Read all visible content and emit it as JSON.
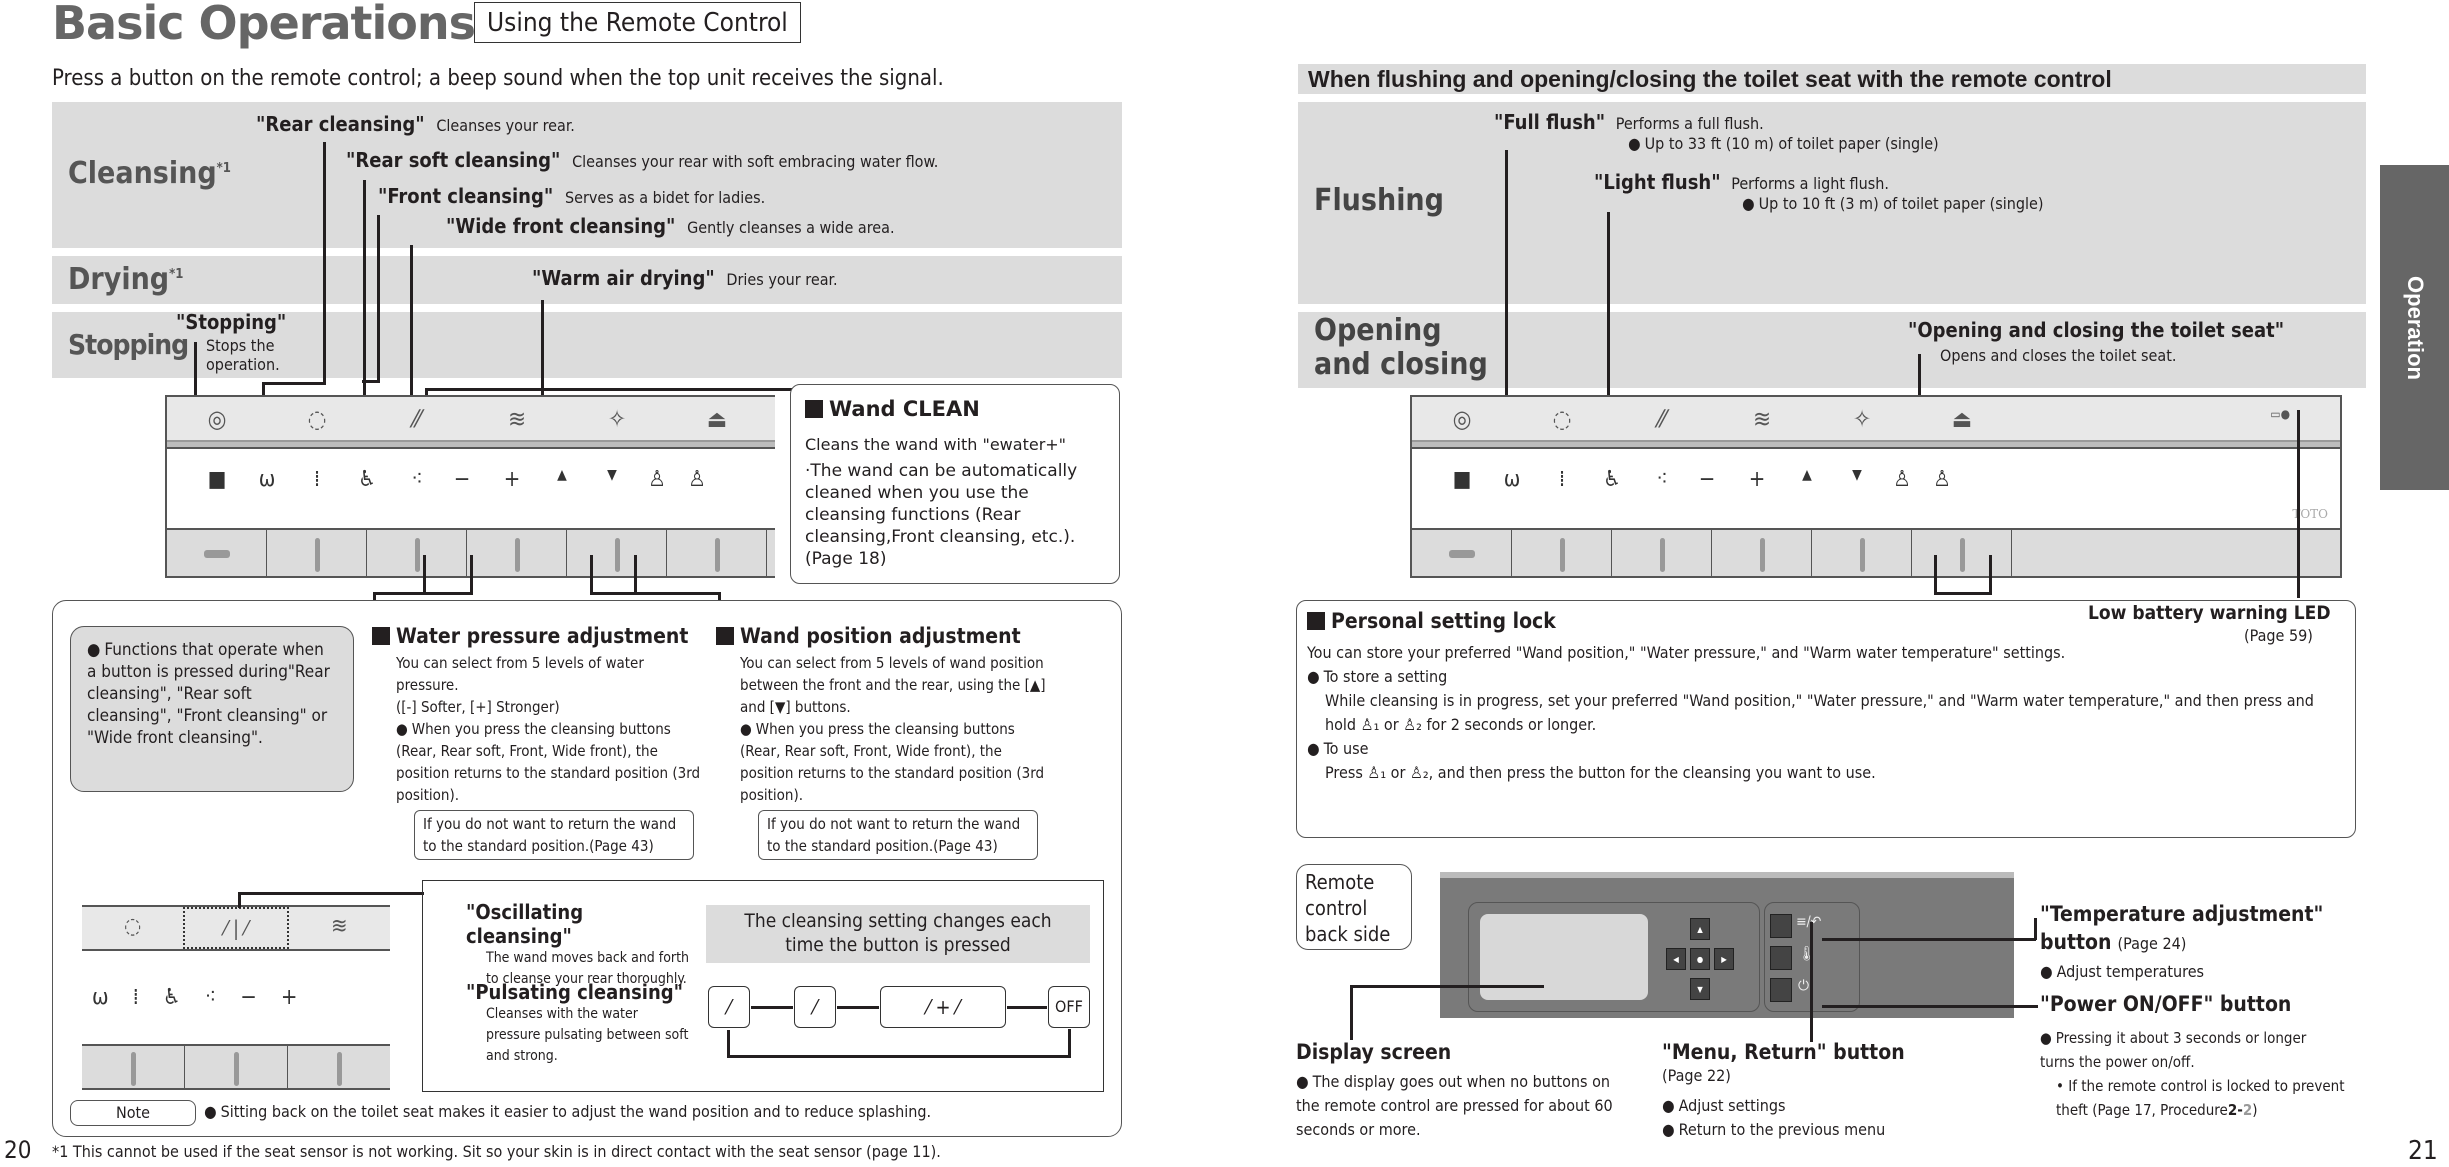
{
  "left_page": {
    "title": "Basic Operations",
    "subtitle": "Using the Remote Control",
    "intro": "Press a button on the remote control; a beep sound when the top unit receives the signal.",
    "sections": {
      "cleansing": {
        "label": "Cleansing",
        "sup": "*1"
      },
      "drying": {
        "label": "Drying",
        "sup": "*1"
      },
      "stopping": {
        "label": "Stopping"
      }
    },
    "functions": [
      {
        "name": "\"Rear cleansing\"",
        "desc": "Cleanses your rear."
      },
      {
        "name": "\"Rear soft cleansing\"",
        "desc": "Cleanses your rear with soft embracing water flow."
      },
      {
        "name": "\"Front cleansing\"",
        "desc": "Serves as a bidet for ladies."
      },
      {
        "name": "\"Wide front cleansing\"",
        "desc": "Gently cleanses a wide area."
      },
      {
        "name": "\"Warm air drying\"",
        "desc": "Dries your rear."
      },
      {
        "name": "\"Stopping\"",
        "desc": "Stops the operation."
      }
    ],
    "panel_top_icons": [
      "rear-spiral-icon",
      "soft-spiral-icon",
      "oscillate-pulsate-icon",
      "warm-air-icon",
      "wand-clean-icon",
      "seat-open-close-icon"
    ],
    "panel_row_icons": [
      "■",
      "ω",
      "⁞",
      "♿",
      "⁖",
      "−",
      "+",
      "▲",
      "▼",
      "1",
      "2"
    ],
    "wand_clean": {
      "title": "Wand CLEAN",
      "line1": "Cleans the wand with \"ewater+\"",
      "line2": "·The wand can be automatically cleaned when you use the cleansing functions (Rear cleansing,Front cleansing, etc.). (Page 18)"
    },
    "functions_note": "Functions that operate when a button is pressed during\"Rear cleansing\", \"Rear soft cleansing\", \"Front cleansing\" or \"Wide front cleansing\".",
    "water_pressure": {
      "title": "Water pressure adjustment",
      "body1": "You can select from 5 levels of water pressure.",
      "body2": "([-] Softer, [+] Stronger)",
      "bullet": "When you press the cleansing buttons (Rear, Rear soft, Front, Wide front), the position returns to the standard position (3rd position).",
      "box": "If you do not want to return the wand to the standard position.(Page 43)"
    },
    "wand_position": {
      "title": "Wand position adjustment",
      "body1": "You can select from 5 levels of wand position between the front and the rear, using the [▲] and [▼] buttons.",
      "bullet": "When you press the cleansing buttons (Rear, Rear soft, Front, Wide front), the position returns to the standard position (3rd position).",
      "box": "If you do not want to return the wand to the standard position.(Page 43)"
    },
    "oscillating": {
      "name": "\"Oscillating cleansing\"",
      "desc": "The wand moves back and forth to cleanse your rear thoroughly."
    },
    "pulsating": {
      "name": "\"Pulsating cleansing\"",
      "desc": "Cleanses with the water pressure pulsating between soft and strong."
    },
    "cycle_caption": "The cleansing setting changes each time the button is pressed",
    "cycle_steps": [
      "oscillating",
      "pulsating",
      "oscillating + pulsating",
      "OFF"
    ],
    "cycle_plus": "+",
    "cycle_off": "OFF",
    "note_label": "Note",
    "note_text": "Sitting back on the toilet seat makes it easier to adjust the wand position and to reduce splashing.",
    "footnote": "*1 This cannot be used if the seat sensor is not working. Sit so your skin is in direct contact with the seat sensor (page 11).",
    "page_number": "20"
  },
  "right_page": {
    "header": "When flushing and opening/closing the toilet seat with the remote control",
    "flushing": {
      "label": "Flushing",
      "full": {
        "name": "\"Full flush\"",
        "desc": "Performs a full flush.",
        "bullet": "Up to 33 ft (10 m) of toilet paper (single)"
      },
      "light": {
        "name": "\"Light flush\"",
        "desc": "Performs a light flush.",
        "bullet": "Up to 10 ft (3 m) of toilet paper (single)"
      }
    },
    "opening": {
      "label1": "Opening",
      "label2": "and closing",
      "name": "\"Opening and closing the toilet seat\"",
      "desc": "Opens and closes the toilet seat."
    },
    "brand": "TOTO",
    "personal_lock": {
      "title": "Personal setting lock",
      "intro": "You can store your preferred \"Wand position,\" \"Water pressure,\" and \"Warm water temperature\" settings.",
      "store_head": "To store a setting",
      "store_body_a": "While cleansing is in progress, set your preferred \"Wand position,\" \"Water pressure,\" and \"Warm water temperature,\" and then press and hold",
      "store_body_b": "for 2 seconds or longer.",
      "use_head": "To use",
      "use_body_a": "Press",
      "use_body_b": ", and then press the button for the cleansing you want to use.",
      "or": "or"
    },
    "low_battery": {
      "title": "Low battery warning LED",
      "page": "(Page 59)"
    },
    "remote_back": "Remote control back side",
    "display_screen": {
      "title": "Display screen",
      "bullet": "The display goes out when no buttons on the remote control are pressed for about 60 seconds or more."
    },
    "menu_return": {
      "title": "\"Menu, Return\" button",
      "page": "(Page 22)",
      "bullets": [
        "Adjust settings",
        "Return to the previous menu"
      ]
    },
    "temperature": {
      "title": "\"Temperature adjustment\"",
      "title2": "button",
      "page": "(Page 24)",
      "bullet": "Adjust temperatures"
    },
    "power": {
      "title": "\"Power ON/OFF\" button",
      "bullet": "Pressing it about 3 seconds or longer turns the power on/off.",
      "sub": "• If the remote control is locked to prevent theft (Page 17, Procedure",
      "sub_bold": "2-",
      "sub_gray": "2",
      "sub_end": ")"
    },
    "remote_labels": {
      "menu": "≡/↶",
      "temp": "🌡",
      "power": "⏻"
    },
    "page_number": "21",
    "side_tab": "Operation"
  }
}
